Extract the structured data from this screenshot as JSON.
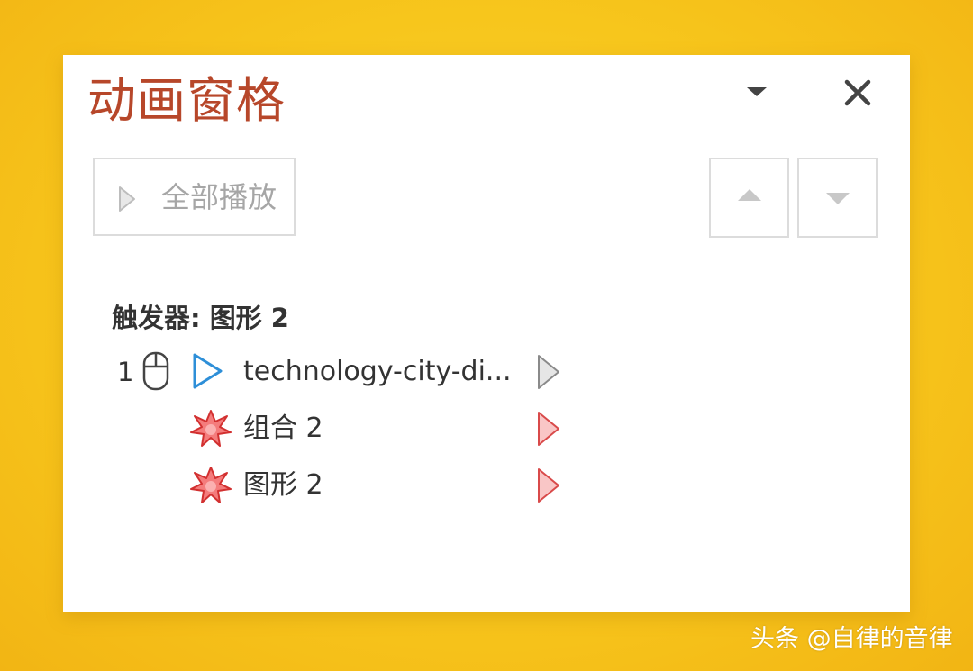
{
  "pane": {
    "title": "动画窗格",
    "title_color": "#b7472a",
    "dropdown_icon": "chevron-down-icon",
    "close_icon": "close-icon"
  },
  "toolbar": {
    "play_all_label": "全部播放",
    "play_icon": "play-icon",
    "move_up_icon": "arrow-up-icon",
    "move_down_icon": "arrow-down-icon"
  },
  "trigger": {
    "label": "触发器: 图形 2"
  },
  "animations": [
    {
      "order": "1",
      "start": "on-click",
      "effect": "entrance-appear",
      "name": "technology-city-di...",
      "effect_color": "#2e8fd8"
    },
    {
      "order": "",
      "start": "with-previous",
      "effect": "emphasis-burst",
      "name": "组合 2",
      "effect_color": "#e34a4a"
    },
    {
      "order": "",
      "start": "with-previous",
      "effect": "emphasis-burst",
      "name": "图形 2",
      "effect_color": "#e34a4a"
    }
  ],
  "watermark": "头条 @自律的音律"
}
